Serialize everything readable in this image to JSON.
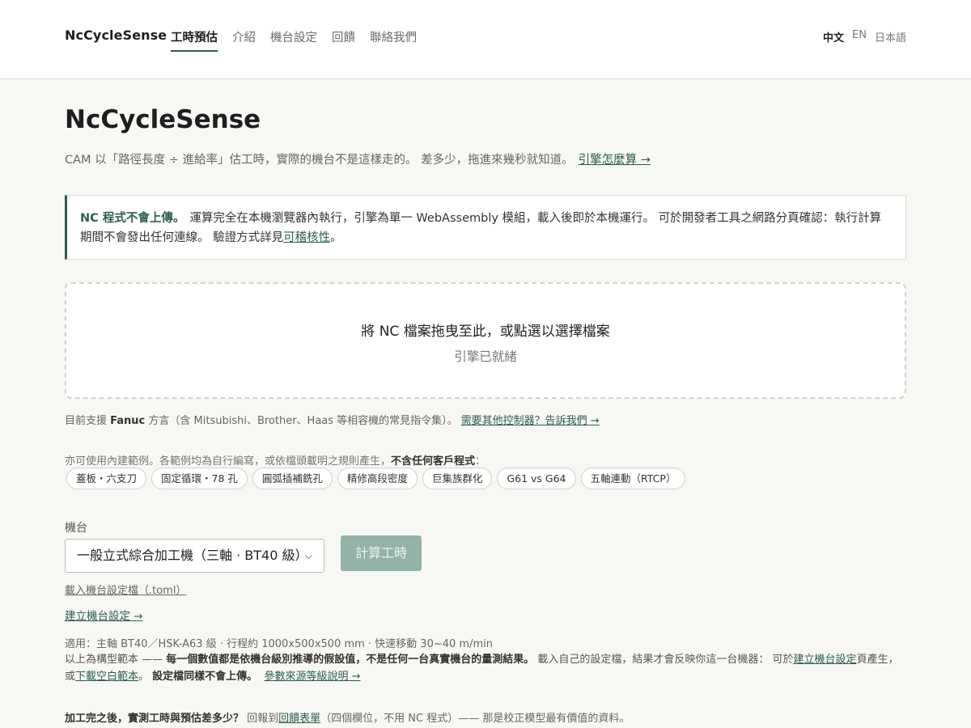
{
  "header": {
    "brand": "NcCycleSense",
    "nav": [
      {
        "label": "工時預估",
        "active": true
      },
      {
        "label": "介紹",
        "active": false
      },
      {
        "label": "機台設定",
        "active": false
      },
      {
        "label": "回饋",
        "active": false
      },
      {
        "label": "聯絡我們",
        "active": false
      }
    ],
    "languages": [
      {
        "label": "中文",
        "active": true
      },
      {
        "label": "EN",
        "active": false
      },
      {
        "label": "日本語",
        "active": false
      }
    ]
  },
  "hero": {
    "title": "NcCycleSense",
    "lede": "CAM 以「路徑長度 ÷ 進給率」估工時，實際的機台不是這樣走的。 差多少，拖進來幾秒就知道。",
    "lede_link": "引擎怎麼算 →"
  },
  "notice": {
    "strong": "NC 程式不會上傳。",
    "text": "運算完全在本機瀏覽器內執行，引擎為單一 WebAssembly 模組，載入後即於本機運行。 可於開發者工具之網路分頁確認：執行計算期間不會發出任何連線。 驗證方式詳見",
    "link": "可稽核性",
    "tail": "。"
  },
  "dropzone": {
    "title": "將 NC 檔案拖曳至此，或點選以選擇檔案",
    "status": "引擎已就緒"
  },
  "support": {
    "prefix": "目前支援 ",
    "dialect": "Fanuc",
    "suffix": " 方言（含 Mitsubishi、Brother、Haas 等相容機的常見指令集）。",
    "link": "需要其他控制器？告訴我們 →"
  },
  "examples": {
    "intro": "亦可使用內建範例。各範例均為自行編寫，或依檔頭載明之規則產生，",
    "intro_strong": "不含任何客戶程式",
    "intro_tail": "：",
    "chips": [
      "蓋板・六支刀",
      "固定循環・78 孔",
      "圓弧插補銑孔",
      "精修高段密度",
      "巨集族群化",
      "G61 vs G64",
      "五軸連動（RTCP）"
    ]
  },
  "machine": {
    "label": "機台",
    "selected": "一般立式綜合加工機（三軸 · BT40 級）",
    "calc_button": "計算工時",
    "load_link": "載入機台設定檔（.toml）",
    "create_link": "建立機台設定 →",
    "applies": "適用：主軸 BT40／HSK-A63 級 · 行程約 1000x500x500 mm · 快速移動 30~40 m/min"
  },
  "note": {
    "p1": "以上為構型範本 —— ",
    "p1_strong": "每一個數值都是依機台級別推導的假設值，不是任何一台真實機台的量測結果。",
    "p2": " 載入自己的設定檔，結果才會反映你這一台機器： 可於",
    "link1": "建立機台設定",
    "p3": "頁產生，或",
    "link2": "下載空白範本",
    "p4": "。 ",
    "p4_strong": "設定檔同樣不會上傳。",
    "link3": "參數來源等級說明 →"
  },
  "feedback": {
    "strong": "加工完之後，實測工時與預估差多少？",
    "text": " 回報到",
    "link": "回饋表單",
    "tail": "（四個欄位，不用 NC 程式）—— 那是校正模型最有價值的資料。"
  },
  "colors": {
    "accent": "#2d5e52",
    "button_disabled": "#93b2a8",
    "background": "#f7f7f4"
  }
}
